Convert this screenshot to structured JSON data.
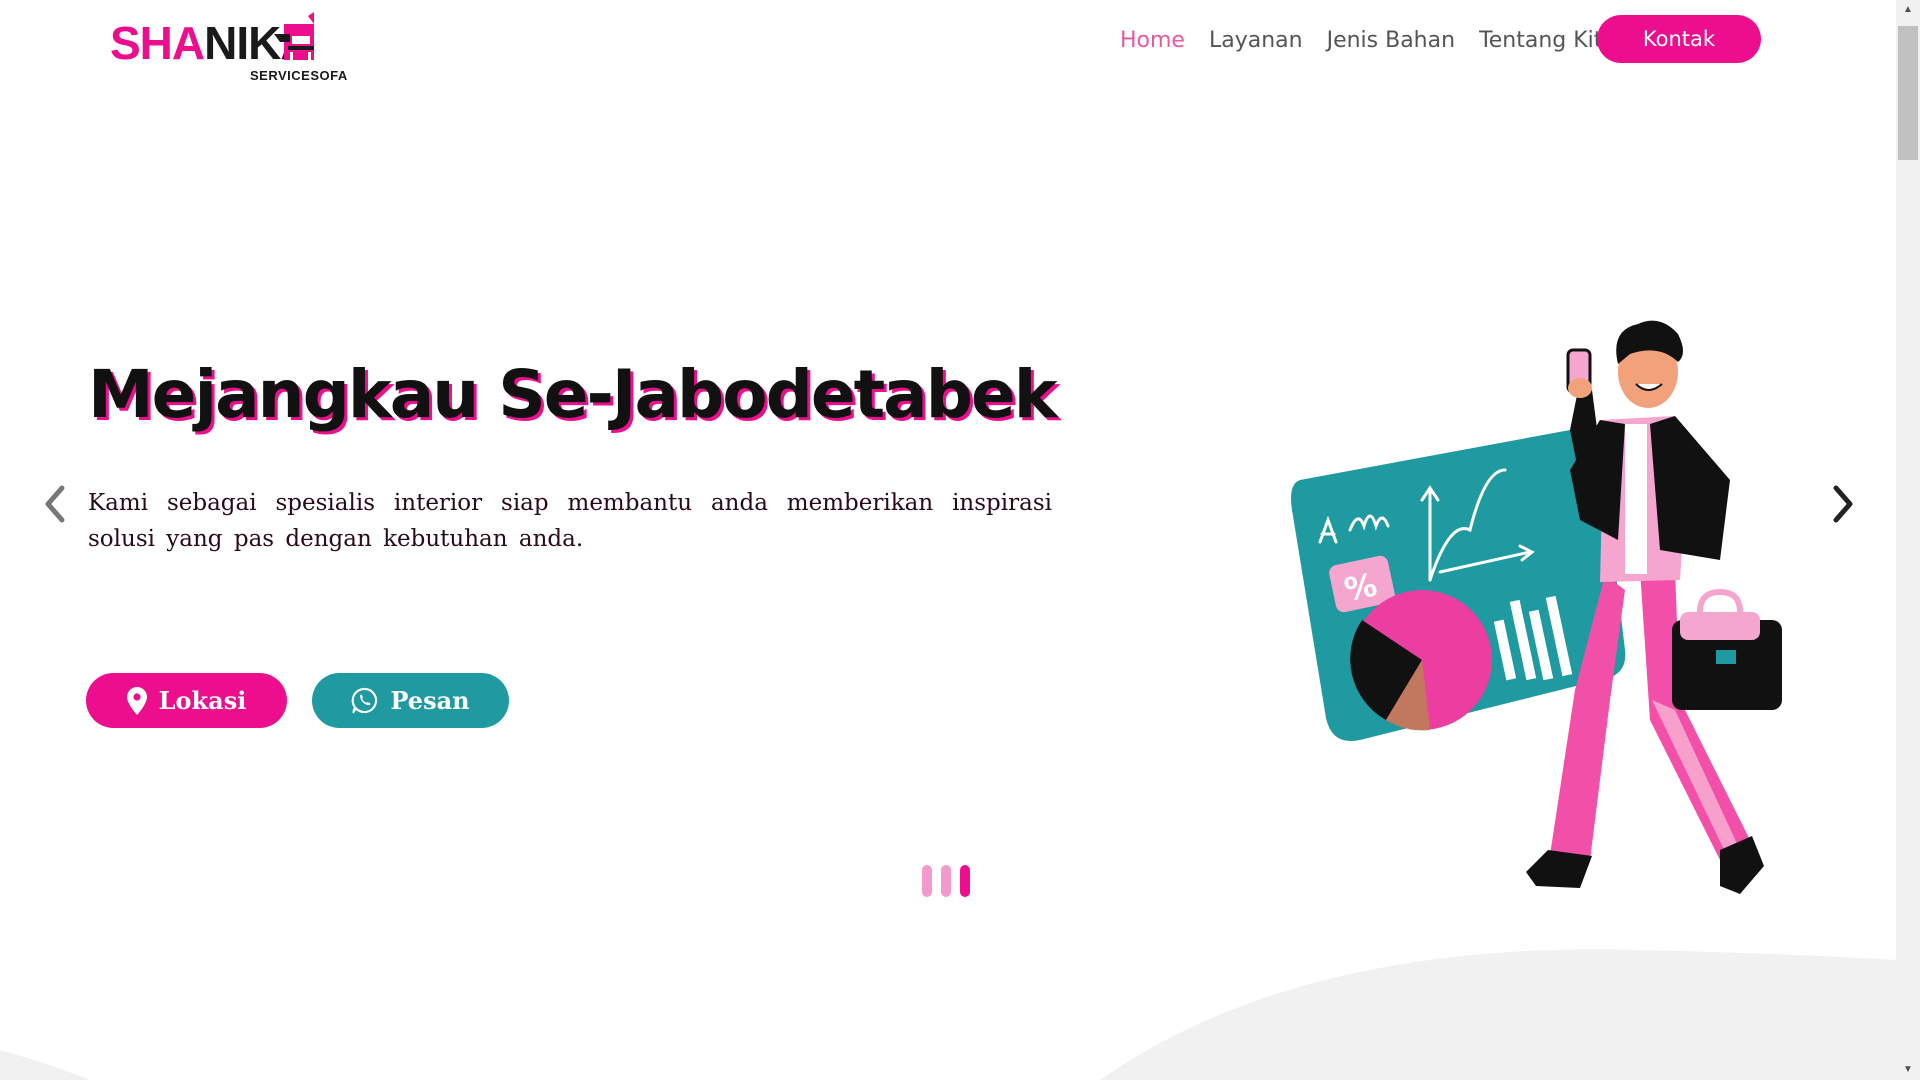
{
  "brand": {
    "part1": "SHA",
    "part2": "NIKA",
    "sub": "SERVICESOFA"
  },
  "nav": {
    "items": [
      {
        "label": "Home",
        "active": true
      },
      {
        "label": "Layanan",
        "active": false
      },
      {
        "label": "Jenis Bahan",
        "active": false
      },
      {
        "label": "Tentang Kita",
        "active": false
      }
    ],
    "cta": "Kontak"
  },
  "hero": {
    "title": "Mejangkau Se-Jabodetabek",
    "text": "Kami sebagai spesialis interior siap membantu anda memberikan inspirasi solusi yang pas dengan kebutuhan anda.",
    "buttons": {
      "lokasi": "Lokasi",
      "pesan": "Pesan"
    }
  },
  "carousel": {
    "slide_count": 3,
    "active_index": 2
  },
  "icons": {
    "location": "map-pin-icon",
    "whatsapp": "whatsapp-icon",
    "prev": "chevron-left-icon",
    "next": "chevron-right-icon"
  },
  "colors": {
    "primary": "#ec0e8c",
    "secondary": "#1e9aa0",
    "nav_active": "#e8599f",
    "indicator_inactive": "#f29acb"
  }
}
